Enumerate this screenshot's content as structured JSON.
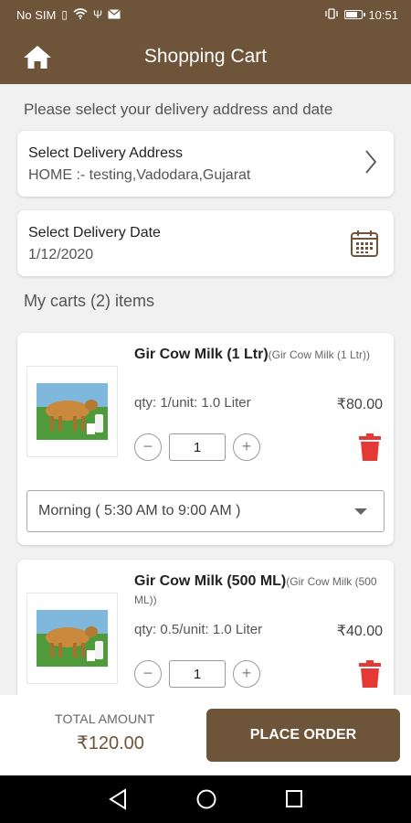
{
  "status_bar": {
    "carrier": "No SIM",
    "time": "10:51"
  },
  "app_bar": {
    "title": "Shopping Cart",
    "home_icon": "home-icon"
  },
  "delivery": {
    "prompt": "Please select your delivery address and date",
    "address_title": "Select Delivery Address",
    "address_value": "HOME :- testing,Vadodara,Gujarat",
    "date_title": "Select Delivery Date",
    "date_value": "1/12/2020"
  },
  "cart": {
    "heading": "My carts (2) items",
    "items": [
      {
        "name": "Gir Cow Milk (1 Ltr)",
        "alt_name": "(Gir Cow Milk (1 Ltr))",
        "qty_line": "qty: 1/unit: 1.0 Liter",
        "price": "₹80.00",
        "quantity": "1",
        "slot": "Morning ( 5:30 AM to 9:00 AM )"
      },
      {
        "name": "Gir Cow Milk (500 ML)",
        "alt_name": "(Gir Cow Milk (500 ML))",
        "qty_line": "qty: 0.5/unit: 1.0 Liter",
        "price": "₹40.00",
        "quantity": "1"
      }
    ]
  },
  "footer": {
    "total_label": "TOTAL AMOUNT",
    "total_value": "₹120.00",
    "place_order": "PLACE ORDER"
  },
  "colors": {
    "brand": "#6e5438",
    "delete": "#e53935"
  }
}
